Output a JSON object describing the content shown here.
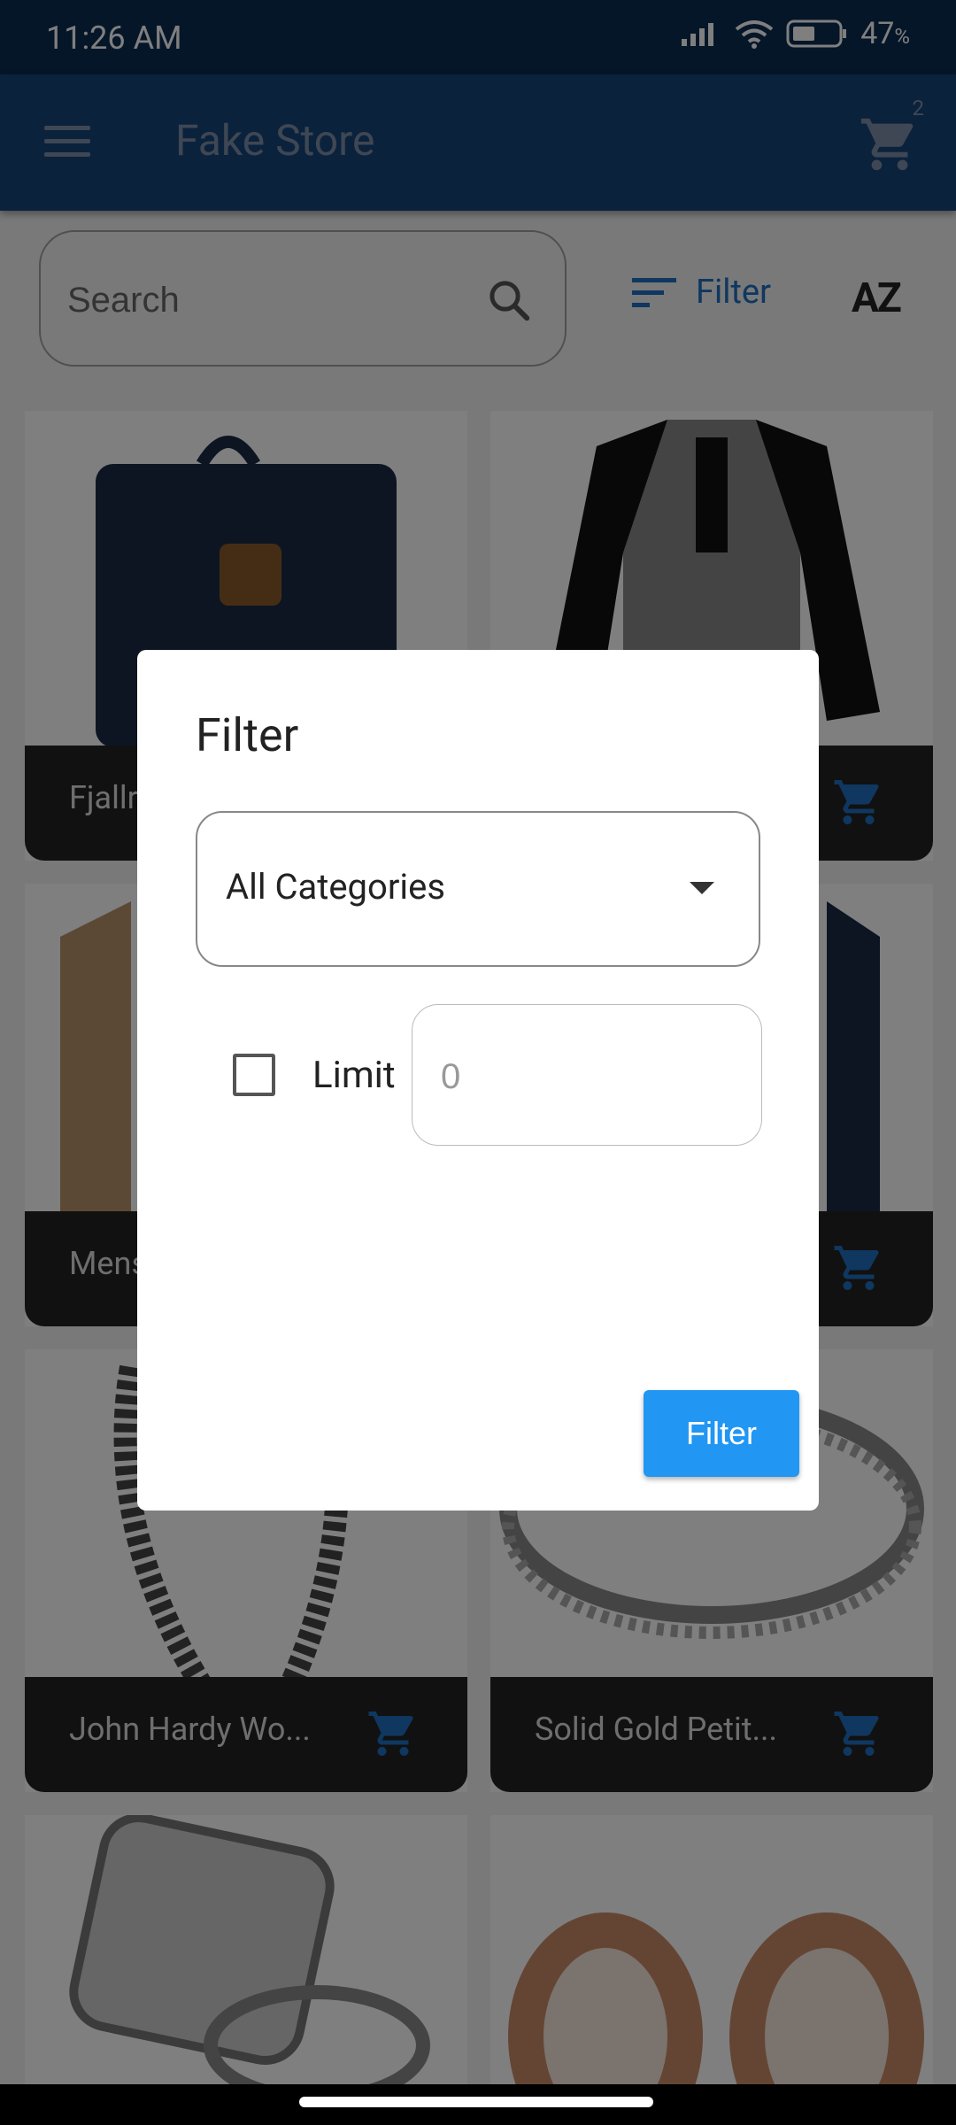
{
  "status_bar": {
    "time": "11:26 AM",
    "battery_percent": "47",
    "battery_unit": "%"
  },
  "app_bar": {
    "title": "Fake Store",
    "cart_count": "2"
  },
  "toolbar": {
    "search_placeholder": "Search",
    "filter_label": "Filter",
    "sort_label": "AZ"
  },
  "products": [
    {
      "title": "Fjallr"
    },
    {
      "title": ""
    },
    {
      "title": "Mens"
    },
    {
      "title": ""
    },
    {
      "title": "John Hardy Wo..."
    },
    {
      "title": "Solid Gold Petit..."
    }
  ],
  "dialog": {
    "title": "Filter",
    "category_selected": "All Categories",
    "limit_label": "Limit",
    "limit_placeholder": "0",
    "limit_checked": false,
    "submit_label": "Filter"
  },
  "colors": {
    "status_bar": "#0c2c52",
    "app_bar": "#16447a",
    "accent": "#2196f3",
    "filter_text": "#1e6fc0"
  }
}
